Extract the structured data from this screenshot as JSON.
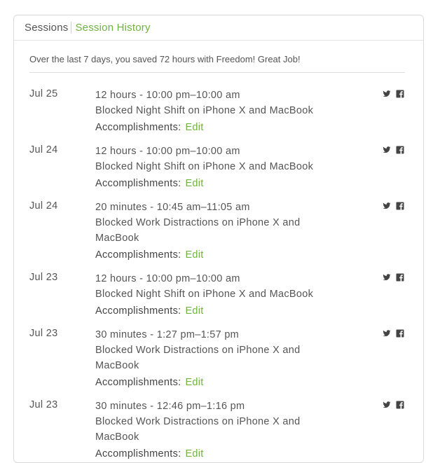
{
  "tabs": {
    "sessions": "Sessions",
    "history": "Session History"
  },
  "summary": "Over the last 7 days, you saved 72 hours with Freedom! Great Job!",
  "accomplishments_label": "Accomplishments:",
  "edit_label": "Edit",
  "colors": {
    "accent": "#6fb33f",
    "text": "#555555",
    "icon": "#444444"
  },
  "sessions": [
    {
      "date": "Jul 25",
      "line1": "12 hours - 10:00 pm–10:00 am",
      "line2": "Blocked Night Shift on iPhone X and MacBook",
      "line3": ""
    },
    {
      "date": "Jul 24",
      "line1": "12 hours - 10:00 pm–10:00 am",
      "line2": "Blocked Night Shift on iPhone X and MacBook",
      "line3": ""
    },
    {
      "date": "Jul 24",
      "line1": "20 minutes - 10:45 am–11:05 am",
      "line2": "Blocked Work Distractions on iPhone X and",
      "line3": "MacBook"
    },
    {
      "date": "Jul 23",
      "line1": "12 hours - 10:00 pm–10:00 am",
      "line2": "Blocked Night Shift on iPhone X and MacBook",
      "line3": ""
    },
    {
      "date": "Jul 23",
      "line1": "30 minutes - 1:27 pm–1:57 pm",
      "line2": "Blocked Work Distractions on iPhone X and",
      "line3": "MacBook"
    },
    {
      "date": "Jul 23",
      "line1": "30 minutes - 12:46 pm–1:16 pm",
      "line2": "Blocked Work Distractions on iPhone X and",
      "line3": "MacBook"
    }
  ]
}
